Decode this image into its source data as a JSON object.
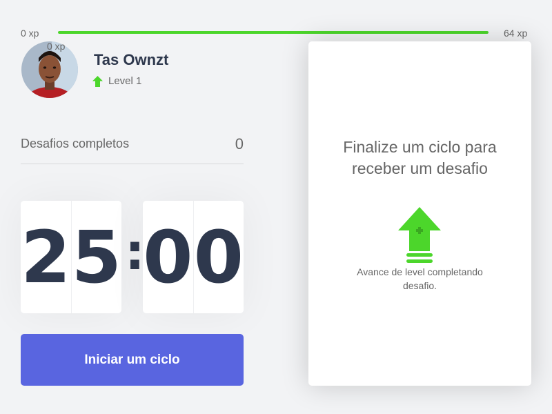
{
  "experience_bar": {
    "min_label": "0 xp",
    "max_label": "64 xp",
    "current_label": "0 xp",
    "progress": 1.0,
    "fill_color": "#4cd62b"
  },
  "profile": {
    "name": "Tas Ownzt",
    "level_label": "Level 1",
    "level_icon": "level-up-arrow-icon"
  },
  "completed_challenges": {
    "label": "Desafios completos",
    "count": "0"
  },
  "countdown": {
    "minute_left": "2",
    "minute_right": "5",
    "separator": ":",
    "second_left": "0",
    "second_right": "0"
  },
  "start_button": {
    "label": "Iniciar um ciclo",
    "color": "#5965e0"
  },
  "challenge_box": {
    "title": "Finalize um ciclo para receber um desafio",
    "hint": "Avance de level completando desafio.",
    "icon": "level-up-arrow-icon"
  }
}
